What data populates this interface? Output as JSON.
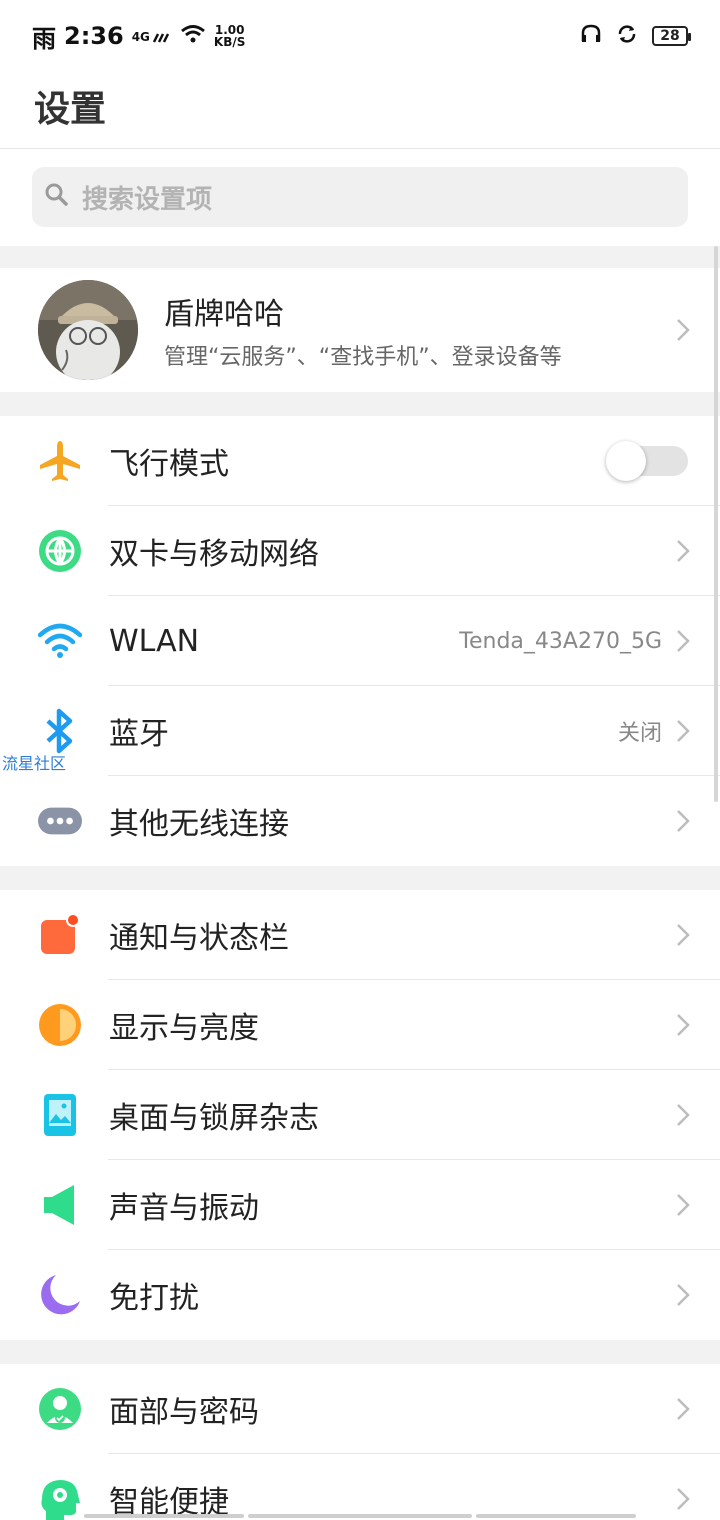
{
  "status_bar": {
    "carrier_text": "雨",
    "time": "2:36",
    "network_type": "4G",
    "speed_value": "1.00",
    "speed_unit": "KB/S",
    "battery": "28"
  },
  "page": {
    "title": "设置"
  },
  "search": {
    "placeholder": "搜索设置项"
  },
  "account": {
    "name": "盾牌哈哈",
    "description": "管理“云服务”、“查找手机”、登录设备等"
  },
  "groups": {
    "connectivity": [
      {
        "label": "飞行模式",
        "icon": "airplane-icon",
        "toggle": false
      },
      {
        "label": "双卡与移动网络",
        "icon": "globe-icon"
      },
      {
        "label": "WLAN",
        "icon": "wifi-icon",
        "value": "Tenda_43A270_5G"
      },
      {
        "label": "蓝牙",
        "icon": "bluetooth-icon",
        "value": "关闭"
      },
      {
        "label": "其他无线连接",
        "icon": "more-dots-icon"
      }
    ],
    "display": [
      {
        "label": "通知与状态栏",
        "icon": "notification-icon"
      },
      {
        "label": "显示与亮度",
        "icon": "brightness-icon"
      },
      {
        "label": "桌面与锁屏杂志",
        "icon": "wallpaper-icon"
      },
      {
        "label": "声音与振动",
        "icon": "speaker-icon"
      },
      {
        "label": "免打扰",
        "icon": "moon-icon"
      }
    ],
    "security": [
      {
        "label": "面部与密码",
        "icon": "face-password-icon"
      },
      {
        "label": "智能便捷",
        "icon": "smart-head-icon"
      }
    ]
  },
  "watermark": "流星社区",
  "colors": {
    "airplane": "#f5a623",
    "globe": "#3ddc84",
    "wifi": "#20a8f0",
    "bluetooth": "#1e9bf0",
    "dots": "#8a94a6",
    "notification": "#ff6a3d",
    "brightness": "#ff9a1f",
    "wallpaper": "#19c3e6",
    "speaker": "#2edc8c",
    "moon": "#9b6cf0",
    "face": "#3ddc84"
  }
}
